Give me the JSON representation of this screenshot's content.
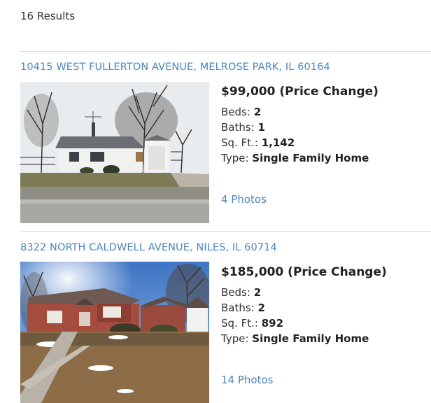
{
  "results": {
    "count_text": "16 Results"
  },
  "listings": [
    {
      "address": "10415 WEST FULLERTON AVENUE, MELROSE PARK, IL 60164",
      "price": "$99,000 (Price Change)",
      "beds_label": "Beds:",
      "beds": "2",
      "baths_label": "Baths:",
      "baths": "1",
      "sqft_label": "Sq. Ft.:",
      "sqft": "1,142",
      "type_label": "Type:",
      "type": "Single Family Home",
      "photos_link": "4 Photos"
    },
    {
      "address": "8322 NORTH CALDWELL AVENUE, NILES, IL 60714",
      "price": "$185,000 (Price Change)",
      "beds_label": "Beds:",
      "beds": "2",
      "baths_label": "Baths:",
      "baths": "2",
      "sqft_label": "Sq. Ft.:",
      "sqft": "892",
      "type_label": "Type:",
      "type": "Single Family Home",
      "photos_link": "14 Photos"
    }
  ],
  "colors": {
    "link": "#4a86bd",
    "divider": "#dcdcdc"
  }
}
